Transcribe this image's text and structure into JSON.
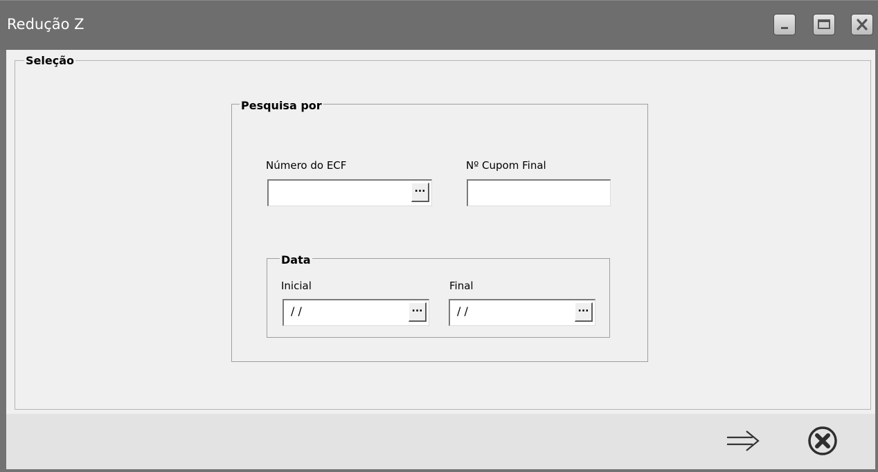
{
  "window": {
    "title": "Redução Z"
  },
  "selecao": {
    "legend": "Seleção"
  },
  "pesquisa": {
    "legend": "Pesquisa por",
    "numero_ecf_label": "Número do ECF",
    "numero_ecf_value": "",
    "cupom_final_label": "Nº Cupom Final",
    "cupom_final_value": "",
    "lookup_label": "..."
  },
  "data": {
    "legend": "Data",
    "inicial_label": "Inicial",
    "inicial_value": "/ /",
    "final_label": "Final",
    "final_value": "/ /"
  },
  "icons": {
    "minimize": "minimize-icon",
    "maximize": "maximize-icon",
    "close": "close-icon",
    "next": "arrow-right-icon",
    "cancel": "cancel-circle-icon"
  }
}
